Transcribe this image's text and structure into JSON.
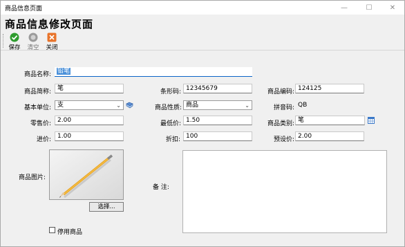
{
  "window": {
    "title": "商品信息页面"
  },
  "page": {
    "heading": "商品信息修改页面"
  },
  "toolbar": {
    "save": "保存",
    "clear": "清空",
    "close": "关闭"
  },
  "form": {
    "name_label": "商品名称:",
    "name_value": "铅笔",
    "short_label": "商品简称:",
    "short_value": "笔",
    "barcode_label": "条形码:",
    "barcode_value": "12345679",
    "code_label": "商品编码:",
    "code_value": "124125",
    "unit_label": "基本单位:",
    "unit_value": "支",
    "nature_label": "商品性质:",
    "nature_value": "商品",
    "pinyin_label": "拼音码:",
    "pinyin_value": "QB",
    "retail_label": "零售价:",
    "retail_value": "2.00",
    "minprice_label": "最低价:",
    "minprice_value": "1.50",
    "category_label": "商品类别:",
    "category_value": "笔",
    "cost_label": "进价:",
    "cost_value": "1.00",
    "discount_label": "折扣:",
    "discount_value": "100",
    "preset_label": "预设价:",
    "preset_value": "2.00",
    "image_label": "商品图片:",
    "choose_button": "选择...",
    "remark_label": "备  注:",
    "disable_label": "停用商品"
  },
  "icons": {
    "save": "check-icon",
    "clear": "clear-icon",
    "close": "close-icon",
    "unit_add": "book-icon",
    "category_pick": "grid-icon"
  },
  "colors": {
    "save": "#2e9c2e",
    "clear": "#9a9a9a",
    "close": "#e8742b",
    "selection": "#4a90d9"
  }
}
